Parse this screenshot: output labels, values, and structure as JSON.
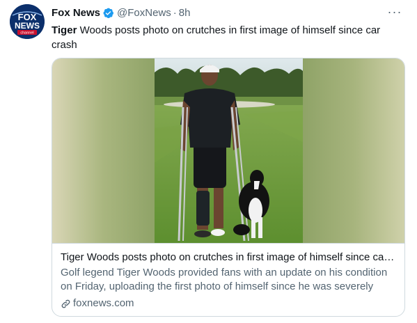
{
  "tweet": {
    "author": {
      "display_name": "Fox News",
      "handle": "@FoxNews",
      "verified": true,
      "avatar_icon": "fox-news-logo",
      "avatar_text_1": "FOX",
      "avatar_text_2": "NEWS",
      "avatar_text_3": "channel"
    },
    "separator": "·",
    "time": "8h",
    "more_icon": "more-horizontal-icon",
    "more_label": "···",
    "text_bold": "Tiger",
    "text_rest": " Woods posts photo on crutches in first image of himself since car crash"
  },
  "card": {
    "image_alt": "Tiger Woods standing on crutches with a dog on a golf course",
    "title": "Tiger Woods posts photo on crutches in first image of himself since car crash",
    "description": "Golf legend Tiger Woods provided fans with an update on his condition on Friday, uploading the first photo of himself since he was severely injured in a car crash",
    "domain": "foxnews.com",
    "domain_icon": "link-icon"
  },
  "colors": {
    "verified": "#1d9bf0",
    "secondary_text": "#536471",
    "border": "#cfd9de",
    "brand_blue": "#0b2f6b"
  }
}
